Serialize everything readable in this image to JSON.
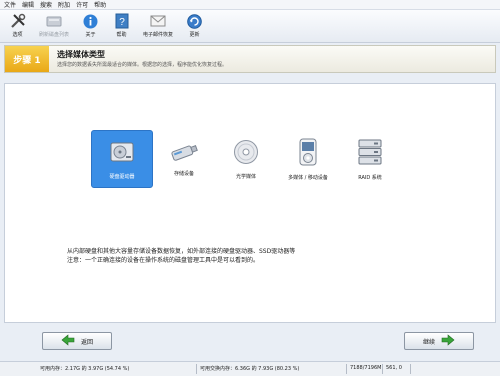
{
  "menu": [
    "文件",
    "编辑",
    "搜索",
    "附加",
    "许可",
    "帮助"
  ],
  "toolbar": [
    {
      "label": "选项",
      "icon": "tools-icon",
      "disabled": false
    },
    {
      "label": "刷新磁盘列表",
      "icon": "refresh-disks-icon",
      "disabled": true
    },
    {
      "label": "关于",
      "icon": "info-icon",
      "disabled": false
    },
    {
      "label": "帮助",
      "icon": "help-icon",
      "disabled": false
    },
    {
      "label": "电子邮件恢复",
      "icon": "email-icon",
      "disabled": false
    },
    {
      "label": "更新",
      "icon": "update-icon",
      "disabled": false
    }
  ],
  "step": {
    "number": "步骤 1",
    "title": "选择媒体类型",
    "description": "选择您的数据丢失所需最适合的媒体。根据您的选择，程序能优化恢复过程。"
  },
  "devices": [
    {
      "label": "硬盘驱动器",
      "icon": "hard-drive-icon",
      "selected": true
    },
    {
      "label": "存储设备",
      "icon": "usb-storage-icon",
      "selected": false
    },
    {
      "label": "光学媒体",
      "icon": "optical-disc-icon",
      "selected": false
    },
    {
      "label": "多媒体 / 移动设备",
      "icon": "media-player-icon",
      "selected": false
    },
    {
      "label": "RAID 系统",
      "icon": "raid-icon",
      "selected": false
    }
  ],
  "info": {
    "line1": "从内部硬盘和其他大容量存储设备数据恢复，如外部连接的硬盘驱动器、SSD驱动器等",
    "line2": "注意：一个正确连接的设备在操作系统的磁盘管理工具中是可以看到的。"
  },
  "buttons": {
    "back": "返回",
    "next": "继续"
  },
  "status": {
    "memory": "可用内存：2.17G 的 3.97G (54.74 %)",
    "swap": "可用交换内存：6.36G 的 7.93G (80.23 %)",
    "mem2": "7188/7196M",
    "coords": "561, 0"
  },
  "colors": {
    "step_accent": "#f0b92a",
    "selected_device": "#3a8ee6"
  }
}
